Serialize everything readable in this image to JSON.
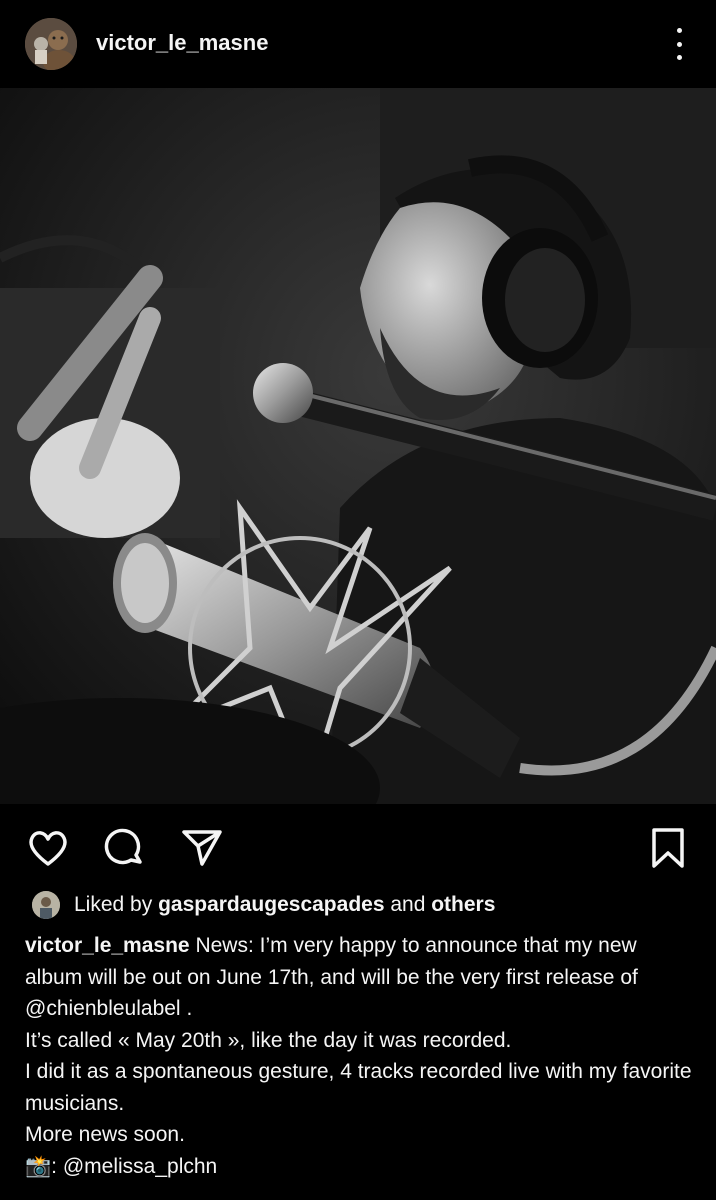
{
  "post": {
    "username": "victor_le_masne",
    "more_options": "more-options-icon"
  },
  "actions": {
    "like_icon": "heart-icon",
    "comment_icon": "comment-icon",
    "share_icon": "send-icon",
    "save_icon": "bookmark-icon"
  },
  "likes": {
    "prefix": "Liked by",
    "user": "gaspardaugescapades",
    "and": "and",
    "others": "others"
  },
  "caption": {
    "author": "victor_le_masne",
    "line1": "News: I’m very happy to announce that my new album will be out on June 17th, and will be the very first release of",
    "mention_label": "@chienbleulabel",
    "line1_end": ".",
    "line2": "It’s called « May 20th », like the day it was recorded.",
    "line3": "I did it as a spontaneous gesture, 4 tracks recorded live with my favorite musicians.",
    "line4": "More news soon.",
    "camera_emoji": "📸",
    "photo_credit_sep": ":",
    "photo_credit": "@melissa_plchn"
  },
  "colors": {
    "background": "#000000",
    "text": "#f5f5f5"
  }
}
